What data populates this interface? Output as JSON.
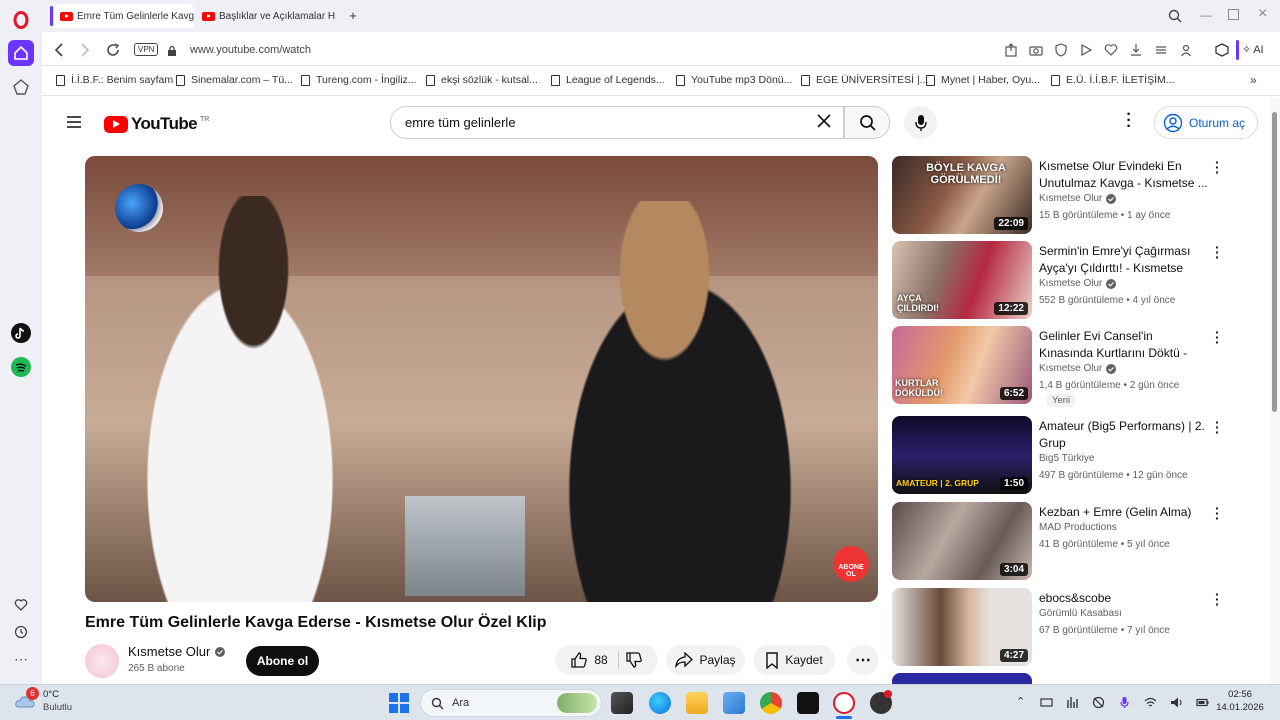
{
  "browser": {
    "tabs": [
      {
        "title": "Emre Tüm Gelinlerle Kavga"
      },
      {
        "title": "Başlıklar ve Açıklamalar H"
      }
    ],
    "vpn_label": "VPN",
    "url": "www.youtube.com/watch",
    "ai_label": "AI",
    "bookmarks": [
      "İ.İ.B.F.: Benim sayfam",
      "Sinemalar.com – Tü...",
      "Tureng.com - İngiliz...",
      "ekşi sözlük - kutsal...",
      "League of Legends...",
      "YouTube mp3 Dönü...",
      "EGE ÜNİVERSİTESİ |...",
      "Mynet | Haber, Oyu...",
      "E.Ü. İ.İ.B.F. İLETİŞİM..."
    ]
  },
  "youtube": {
    "logo_text": "YouTube",
    "region": "TR",
    "search_value": "emre tüm gelinlerle",
    "signin_label": "Oturum aç",
    "video": {
      "title": "Emre Tüm Gelinlerle Kavga Ederse - Kısmetse Olur Özel Klip",
      "channel": "Kısmetse Olur",
      "subscribers": "265 B abone",
      "subscribe_label": "Abone ol",
      "likes": "88",
      "share_label": "Paylaş",
      "save_label": "Kaydet",
      "overlay_badge": "ABONE OL"
    },
    "recommendations": [
      {
        "title": "Kısmetse Olur Evindeki En Unutulmaz Kavga - Kısmetse ...",
        "channel": "Kısmetse Olur",
        "verified": true,
        "meta": "15 B görüntüleme • 1 ay önce",
        "duration": "22:09",
        "thumb_text": "BÖYLE KAVGA GÖRÜLMEDİ!",
        "badge": ""
      },
      {
        "title": "Sermin'in Emre'yi Çağırması Ayça'yı Çıldırttı! - Kısmetse Olu...",
        "channel": "Kısmetse Olur",
        "verified": true,
        "meta": "552 B görüntüleme • 4 yıl önce",
        "duration": "12:22",
        "thumb_text": "AYÇA ÇILDIRDI!",
        "badge": ""
      },
      {
        "title": "Gelinler Evi Cansel'in Kınasında Kurtlarını Döktü - Kısmetse Ol...",
        "channel": "Kısmetse Olur",
        "verified": true,
        "meta": "1,4 B görüntüleme • 2 gün önce",
        "duration": "6:52",
        "thumb_text": "KURTLAR DÖKÜLDÜ!",
        "badge": "Yeni"
      },
      {
        "title": "Amateur (Big5 Performans) | 2. Grup",
        "channel": "Big5 Türkiye",
        "verified": false,
        "meta": "497 B görüntüleme • 12 gün önce",
        "duration": "1:50",
        "thumb_text": "AMATEUR | 2. GRUP",
        "badge": ""
      },
      {
        "title": "Kezban + Emre (Gelin Alma)",
        "channel": "MAD Productions",
        "verified": false,
        "meta": "41 B görüntüleme • 5 yıl önce",
        "duration": "3:04",
        "thumb_text": "",
        "badge": ""
      },
      {
        "title": "ebocs&scobe",
        "channel": "Görümlü Kasabası",
        "verified": false,
        "meta": "67 B görüntüleme • 7 yıl önce",
        "duration": "4:27",
        "thumb_text": "",
        "badge": ""
      }
    ]
  },
  "taskbar": {
    "weather_temp": "0°C",
    "weather_desc": "Bulutlu",
    "weather_badge": "6",
    "search_label": "Ara",
    "time": "02:56",
    "date": "14.01.2026"
  }
}
